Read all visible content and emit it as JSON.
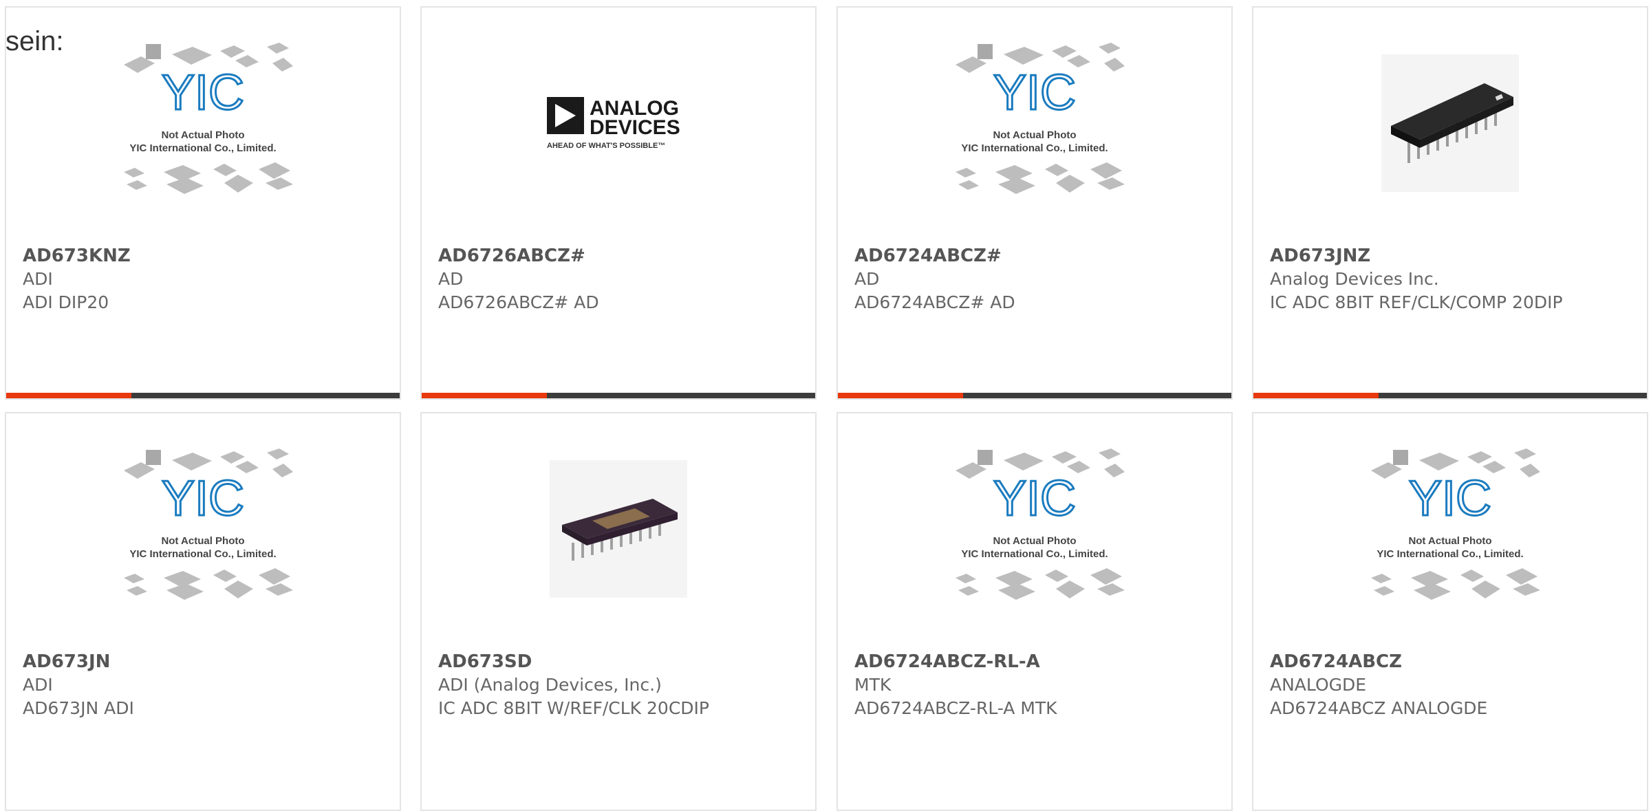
{
  "heading": "sein:",
  "placeholder": {
    "line1": "Not Actual Photo",
    "line2": "YIC International Co., Limited.",
    "logo": "YIC"
  },
  "adi_logo": {
    "line1": "ANALOG",
    "line2": "DEVICES",
    "tagline": "AHEAD OF WHAT'S POSSIBLE™"
  },
  "colors": {
    "accent": "#e8380d",
    "bar": "#3c3c3c",
    "yic_blue": "#1a7bbf"
  },
  "products": [
    {
      "part": "AD673KNZ",
      "maker": "ADI",
      "desc": "ADI DIP20",
      "image": "placeholder-icon"
    },
    {
      "part": "AD6726ABCZ#",
      "maker": "AD",
      "desc": "AD6726ABCZ# AD",
      "image": "analog-devices-logo"
    },
    {
      "part": "AD6724ABCZ#",
      "maker": "AD",
      "desc": "AD6724ABCZ# AD",
      "image": "placeholder-icon"
    },
    {
      "part": "AD673JNZ",
      "maker": "Analog Devices Inc.",
      "desc": "IC ADC 8BIT REF/CLK/COMP 20DIP",
      "image": "dip-chip-black"
    },
    {
      "part": "AD673JN",
      "maker": "ADI",
      "desc": "AD673JN ADI",
      "image": "placeholder-icon"
    },
    {
      "part": "AD673SD",
      "maker": "ADI (Analog Devices, Inc.)",
      "desc": "IC ADC 8BIT W/REF/CLK 20CDIP",
      "image": "dip-chip-ceramic"
    },
    {
      "part": "AD6724ABCZ-RL-A",
      "maker": "MTK",
      "desc": "AD6724ABCZ-RL-A MTK",
      "image": "placeholder-icon"
    },
    {
      "part": "AD6724ABCZ",
      "maker": "ANALOGDE",
      "desc": "AD6724ABCZ ANALOGDE",
      "image": "placeholder-icon"
    }
  ]
}
